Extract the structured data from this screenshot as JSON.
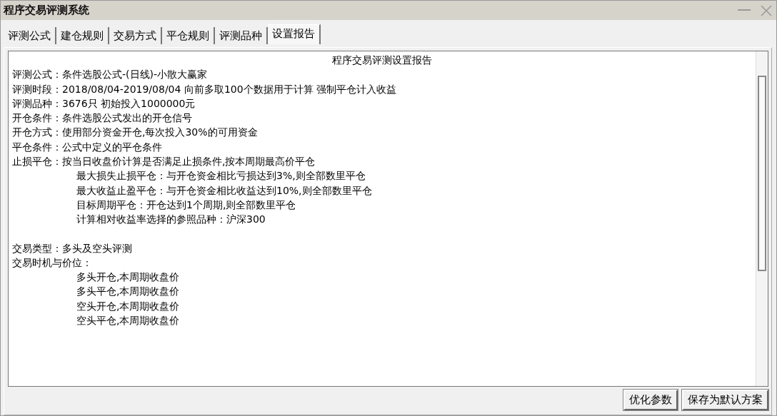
{
  "window": {
    "title": "程序交易评测系统"
  },
  "tabs": [
    {
      "label": "评测公式",
      "selected": false
    },
    {
      "label": "建仓规则",
      "selected": false
    },
    {
      "label": "交易方式",
      "selected": false
    },
    {
      "label": "平仓规则",
      "selected": false
    },
    {
      "label": "评测品种",
      "selected": false
    },
    {
      "label": "设置报告",
      "selected": true
    }
  ],
  "report": {
    "title": "程序交易评测设置报告",
    "sections": [
      {
        "lines": [
          {
            "text": "评测公式：条件选股公式-(日线)-小散大赢家"
          },
          {
            "text": "评测时段：2018/08/04-2019/08/04 向前多取100个数据用于计算 强制平仓计入收益"
          },
          {
            "text": "评测品种：3676只 初始投入1000000元"
          },
          {
            "text": "开仓条件：条件选股公式发出的开仓信号"
          },
          {
            "text": "开仓方式：使用部分资金开仓,每次投入30%的可用资金"
          },
          {
            "text": "平仓条件：公式中定义的平仓条件"
          },
          {
            "text": "止损平仓：按当日收盘价计算是否满足止损条件,按本周期最高价平仓",
            "children": [
              {
                "text": "最大损失止损平仓：与开仓资金相比亏损达到3%,则全部数里平仓"
              },
              {
                "text": "最大收益止盈平仓：与开仓资金相比收益达到10%,则全部数里平仓"
              },
              {
                "text": "目标周期平仓：开仓达到1个周期,则全部数里平仓"
              },
              {
                "text": "计算相对收益率选择的参照品种：沪深300"
              }
            ]
          }
        ]
      },
      {
        "lines": [
          {
            "text": "交易类型：多头及空头评测"
          },
          {
            "text": "交易时机与价位：",
            "children": [
              {
                "text": "多头开仓,本周期收盘价"
              },
              {
                "text": "多头平仓,本周期收盘价"
              },
              {
                "text": "空头开仓,本周期收盘价"
              },
              {
                "text": "空头平仓,本周期收盘价"
              }
            ]
          }
        ]
      }
    ]
  },
  "buttons": [
    "优化参数",
    "保存为默认方案"
  ]
}
